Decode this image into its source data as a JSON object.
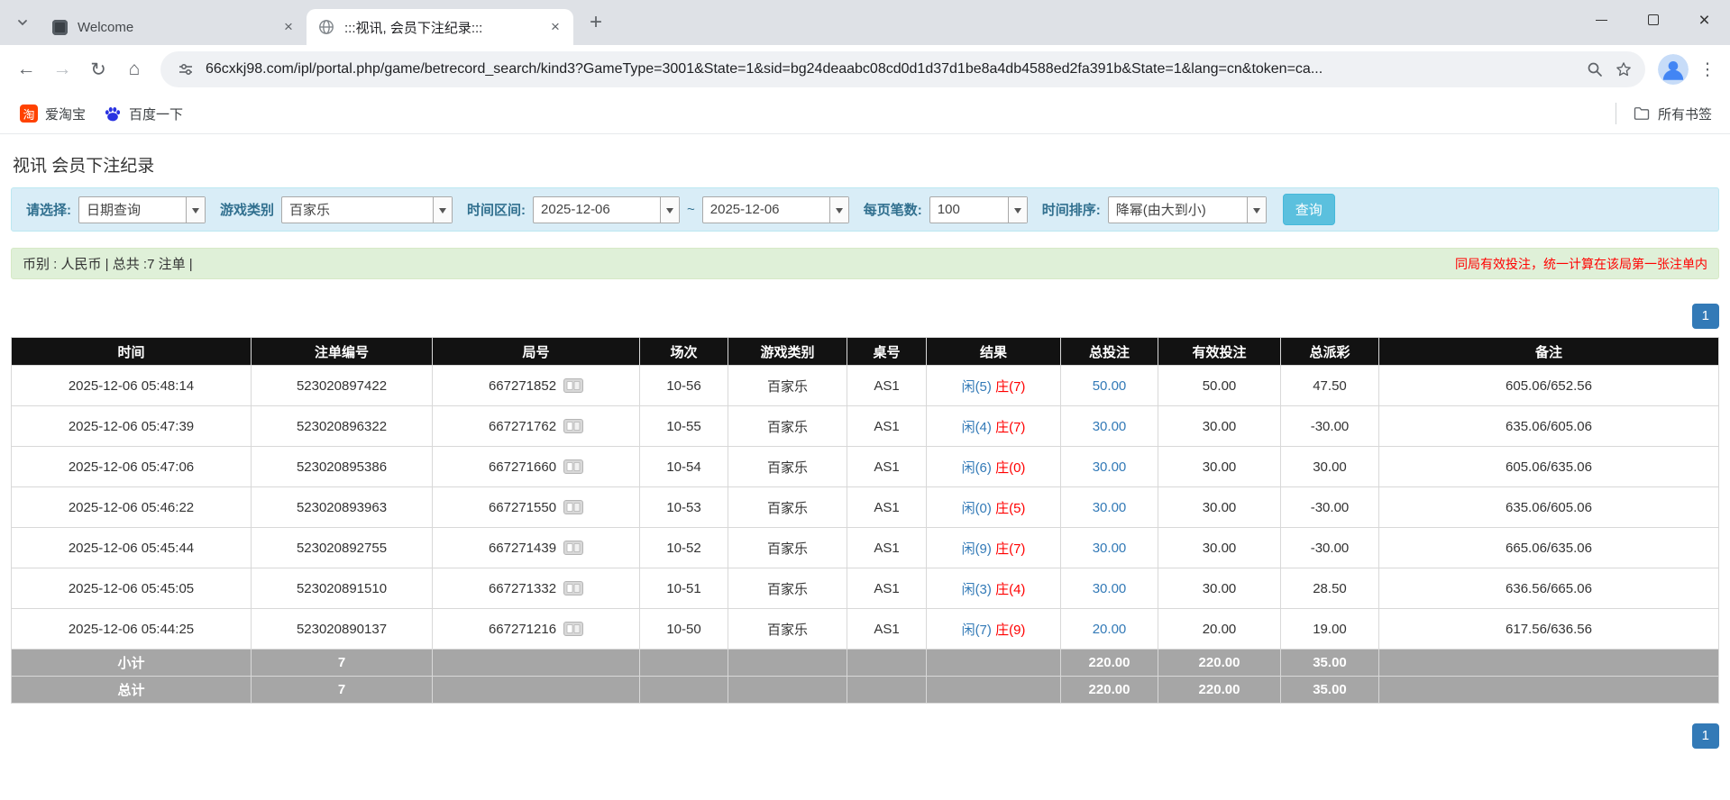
{
  "colors": {
    "accent_blue": "#337ab7",
    "player_blue": "#337ab7",
    "banker_red": "#ff0000",
    "negative_red": "#ff0000",
    "notice_red": "#ff0000",
    "search_button_bg": "#5bc0de",
    "table_header_bg": "#121212",
    "summary_row_bg": "#a6a6a6",
    "filter_bar_bg": "#d9edf7",
    "info_bar_bg": "#dff0d8"
  },
  "browser": {
    "tabs": [
      {
        "title": "Welcome"
      },
      {
        "title": ":::视讯, 会员下注纪录:::"
      }
    ],
    "url": "66cxkj98.com/ipl/portal.php/game/betrecord_search/kind3?GameType=3001&State=1&sid=bg24deaabc08cd0d1d37d1be8a4db4588ed2fa391b&State=1&lang=cn&token=ca...",
    "bookmarks": [
      {
        "label": "爱淘宝",
        "icon_glyph": "淘"
      },
      {
        "label": "百度一下"
      }
    ],
    "all_bookmarks_label": "所有书签"
  },
  "page": {
    "title": "视讯 会员下注纪录",
    "filters": {
      "select_label": "请选择:",
      "select_value": "日期查询",
      "game_type_label": "游戏类别",
      "game_type_value": "百家乐",
      "date_range_label": "时间区间:",
      "date_from": "2025-12-06",
      "range_separator": "~",
      "date_to": "2025-12-06",
      "page_size_label": "每页笔数:",
      "page_size_value": "100",
      "sort_label": "时间排序:",
      "sort_value": "降幂(由大到小)",
      "search_button": "查询"
    },
    "summary": {
      "left_text": "币别 : 人民币 | 总共 :7 注单 |",
      "right_note": "同局有效投注，统一计算在该局第一张注单内"
    },
    "pagination": {
      "current_page": "1"
    },
    "table": {
      "headers": [
        "时间",
        "注单编号",
        "局号",
        "场次",
        "游戏类别",
        "桌号",
        "结果",
        "总投注",
        "有效投注",
        "总派彩",
        "备注"
      ],
      "rows": [
        {
          "time": "2025-12-06 05:48:14",
          "bet_no": "523020897422",
          "round_no": "667271852",
          "session": "10-56",
          "game": "百家乐",
          "table_no": "AS1",
          "result_player": "闲(5)",
          "result_banker": "庄(7)",
          "total_bet": "50.00",
          "valid_bet": "50.00",
          "payout": "47.50",
          "note": "605.06/652.56"
        },
        {
          "time": "2025-12-06 05:47:39",
          "bet_no": "523020896322",
          "round_no": "667271762",
          "session": "10-55",
          "game": "百家乐",
          "table_no": "AS1",
          "result_player": "闲(4)",
          "result_banker": "庄(7)",
          "total_bet": "30.00",
          "valid_bet": "30.00",
          "payout": "-30.00",
          "note": "635.06/605.06"
        },
        {
          "time": "2025-12-06 05:47:06",
          "bet_no": "523020895386",
          "round_no": "667271660",
          "session": "10-54",
          "game": "百家乐",
          "table_no": "AS1",
          "result_player": "闲(6)",
          "result_banker": "庄(0)",
          "total_bet": "30.00",
          "valid_bet": "30.00",
          "payout": "30.00",
          "note": "605.06/635.06"
        },
        {
          "time": "2025-12-06 05:46:22",
          "bet_no": "523020893963",
          "round_no": "667271550",
          "session": "10-53",
          "game": "百家乐",
          "table_no": "AS1",
          "result_player": "闲(0)",
          "result_banker": "庄(5)",
          "total_bet": "30.00",
          "valid_bet": "30.00",
          "payout": "-30.00",
          "note": "635.06/605.06"
        },
        {
          "time": "2025-12-06 05:45:44",
          "bet_no": "523020892755",
          "round_no": "667271439",
          "session": "10-52",
          "game": "百家乐",
          "table_no": "AS1",
          "result_player": "闲(9)",
          "result_banker": "庄(7)",
          "total_bet": "30.00",
          "valid_bet": "30.00",
          "payout": "-30.00",
          "note": "665.06/635.06"
        },
        {
          "time": "2025-12-06 05:45:05",
          "bet_no": "523020891510",
          "round_no": "667271332",
          "session": "10-51",
          "game": "百家乐",
          "table_no": "AS1",
          "result_player": "闲(3)",
          "result_banker": "庄(4)",
          "total_bet": "30.00",
          "valid_bet": "30.00",
          "payout": "28.50",
          "note": "636.56/665.06"
        },
        {
          "time": "2025-12-06 05:44:25",
          "bet_no": "523020890137",
          "round_no": "667271216",
          "session": "10-50",
          "game": "百家乐",
          "table_no": "AS1",
          "result_player": "闲(7)",
          "result_banker": "庄(9)",
          "total_bet": "20.00",
          "valid_bet": "20.00",
          "payout": "19.00",
          "note": "617.56/636.56"
        }
      ],
      "subtotal": {
        "label": "小计",
        "count": "7",
        "total_bet": "220.00",
        "valid_bet": "220.00",
        "payout": "35.00"
      },
      "grand_total": {
        "label": "总计",
        "count": "7",
        "total_bet": "220.00",
        "valid_bet": "220.00",
        "payout": "35.00"
      }
    }
  }
}
